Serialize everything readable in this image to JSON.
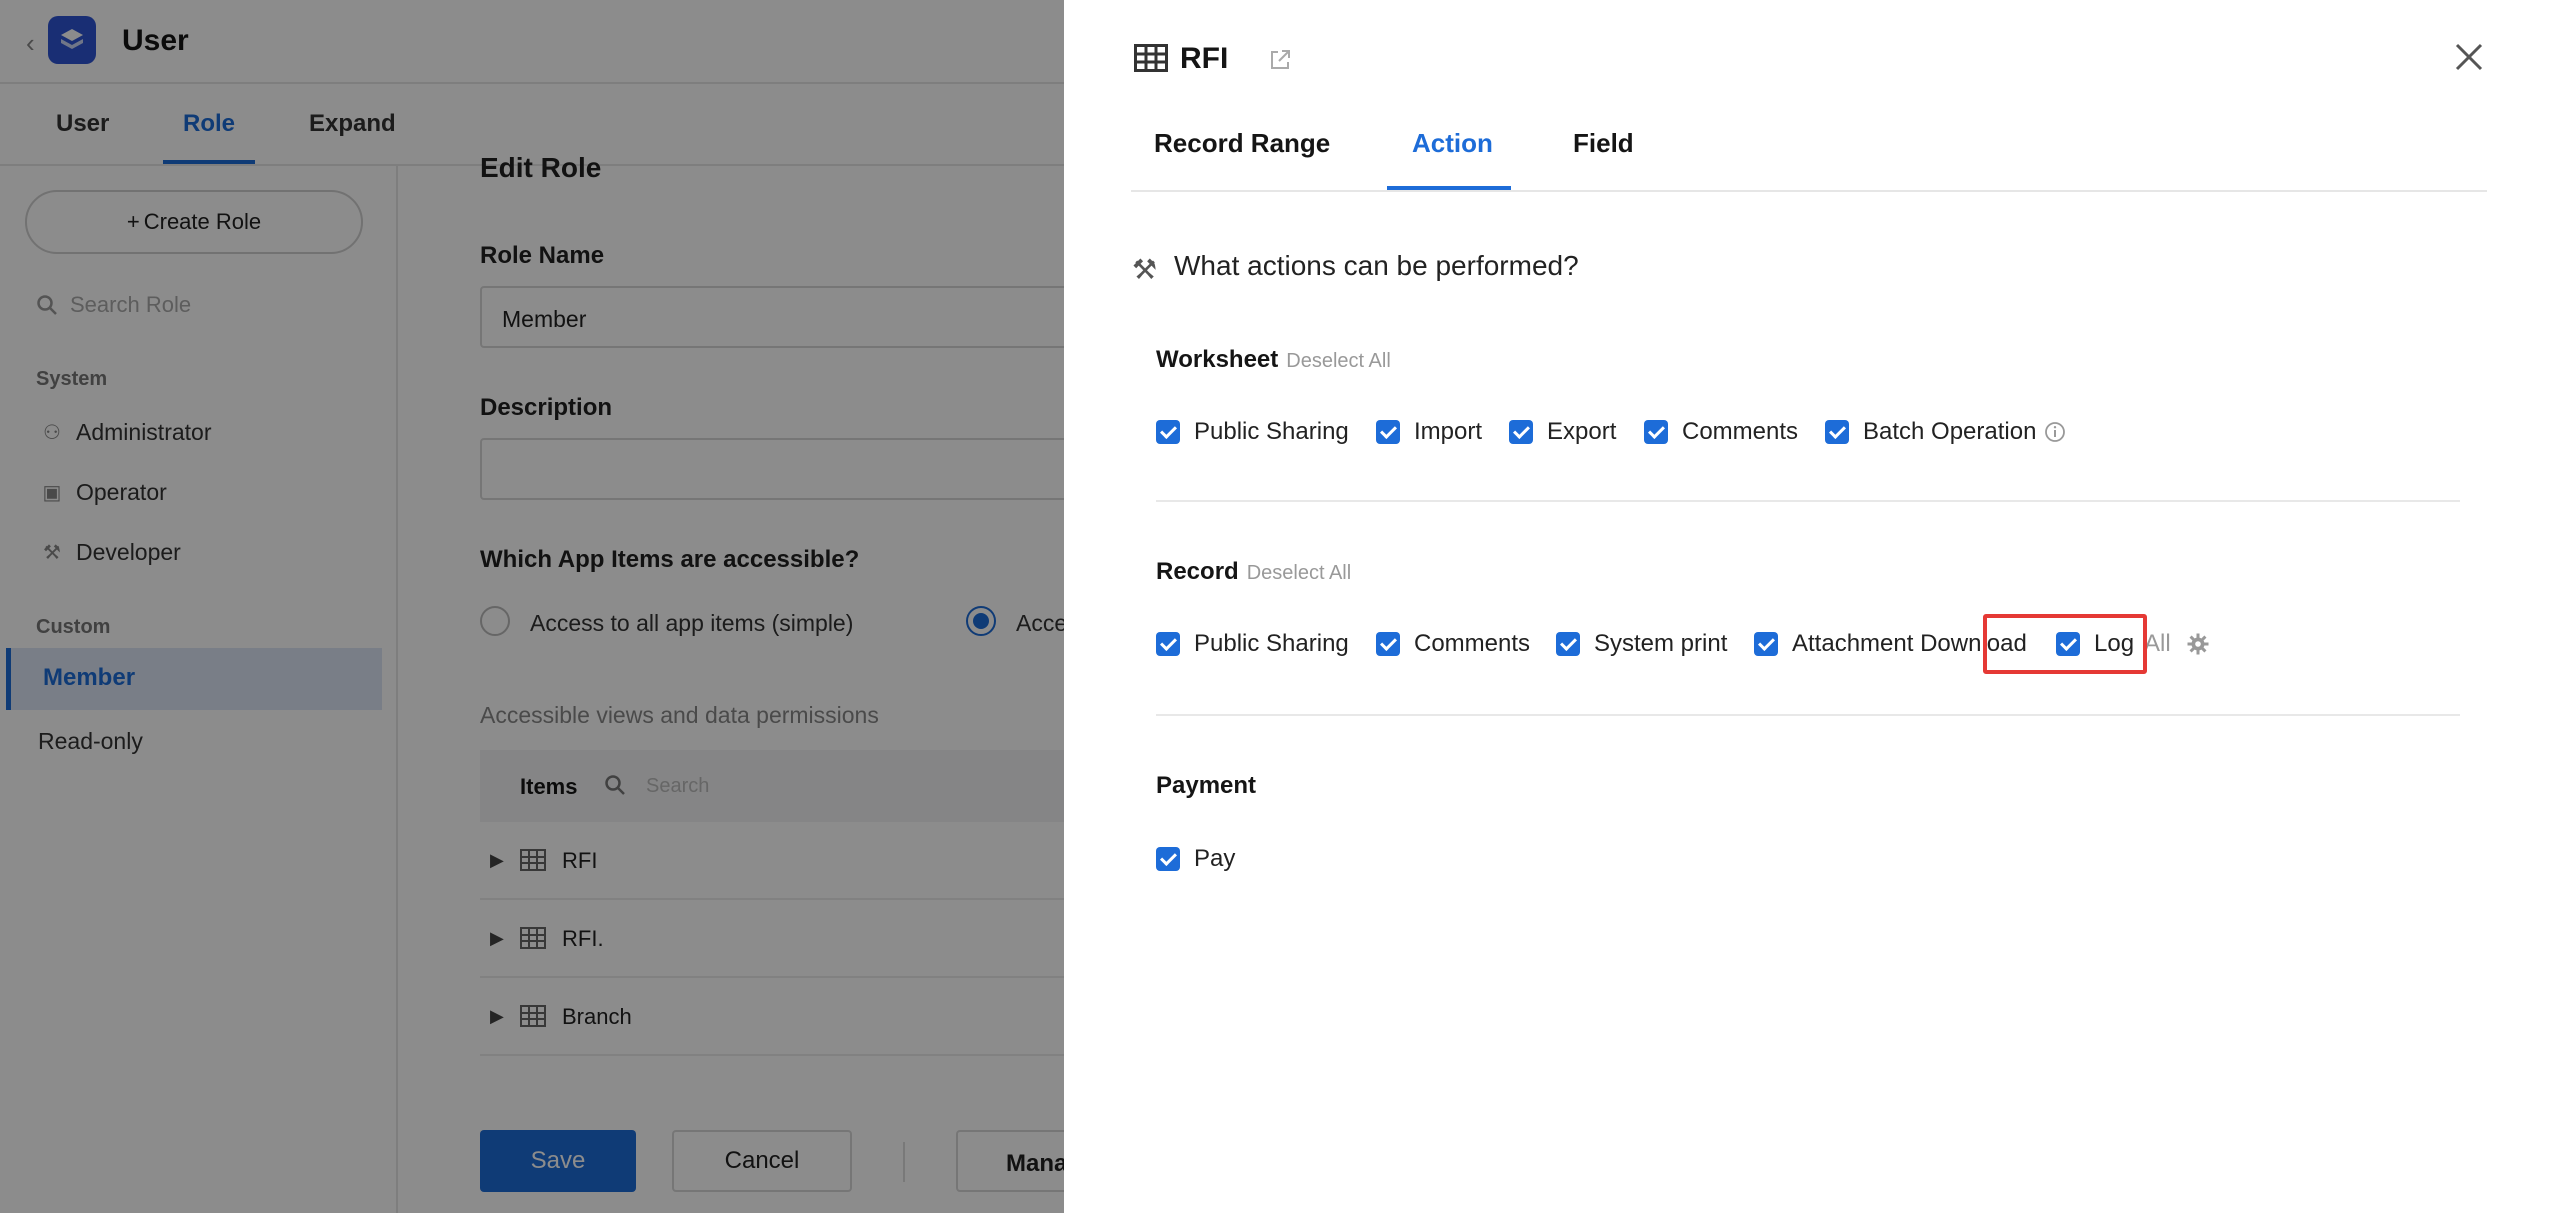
{
  "app": {
    "title": "User",
    "tabs": [
      "User",
      "Role",
      "Expand"
    ],
    "active_tab": "Role"
  },
  "sidebar": {
    "create_role": "Create Role",
    "search_placeholder": "Search Role",
    "system_label": "System",
    "system_items": [
      {
        "label": "Administrator",
        "icon": "admin-icon"
      },
      {
        "label": "Operator",
        "icon": "operator-icon"
      },
      {
        "label": "Developer",
        "icon": "developer-icon"
      }
    ],
    "custom_label": "Custom",
    "custom_items": [
      "Member",
      "Read-only"
    ],
    "active_item": "Member"
  },
  "edit_role": {
    "heading": "Edit Role",
    "role_name_label": "Role Name",
    "role_name_value": "Member",
    "description_label": "Description",
    "description_value": "",
    "access_question": "Which App Items are accessible?",
    "access_simple": "Access to all app items (simple)",
    "access_custom": "Acce",
    "views_label": "Accessible views and data permissions",
    "items_header": "Items",
    "items_search_placeholder": "Search",
    "items": [
      "RFI",
      "RFI.",
      "Branch"
    ],
    "save": "Save",
    "cancel": "Cancel",
    "manage": "Mana"
  },
  "drawer": {
    "title": "RFI",
    "tabs": [
      "Record Range",
      "Action",
      "Field"
    ],
    "active_tab": "Action",
    "question": "What actions can be performed?",
    "worksheet": {
      "title": "Worksheet",
      "deselect": "Deselect All",
      "options": [
        "Public Sharing",
        "Import",
        "Export",
        "Comments",
        "Batch Operation"
      ]
    },
    "record": {
      "title": "Record",
      "deselect": "Deselect All",
      "options": [
        "Public Sharing",
        "Comments",
        "System print",
        "Attachment Download"
      ],
      "log_label": "Log",
      "log_scope": "All"
    },
    "payment": {
      "title": "Payment",
      "options": [
        "Pay"
      ]
    },
    "colors": {
      "accent": "#1d6cd8",
      "highlight": "#e53935"
    }
  }
}
